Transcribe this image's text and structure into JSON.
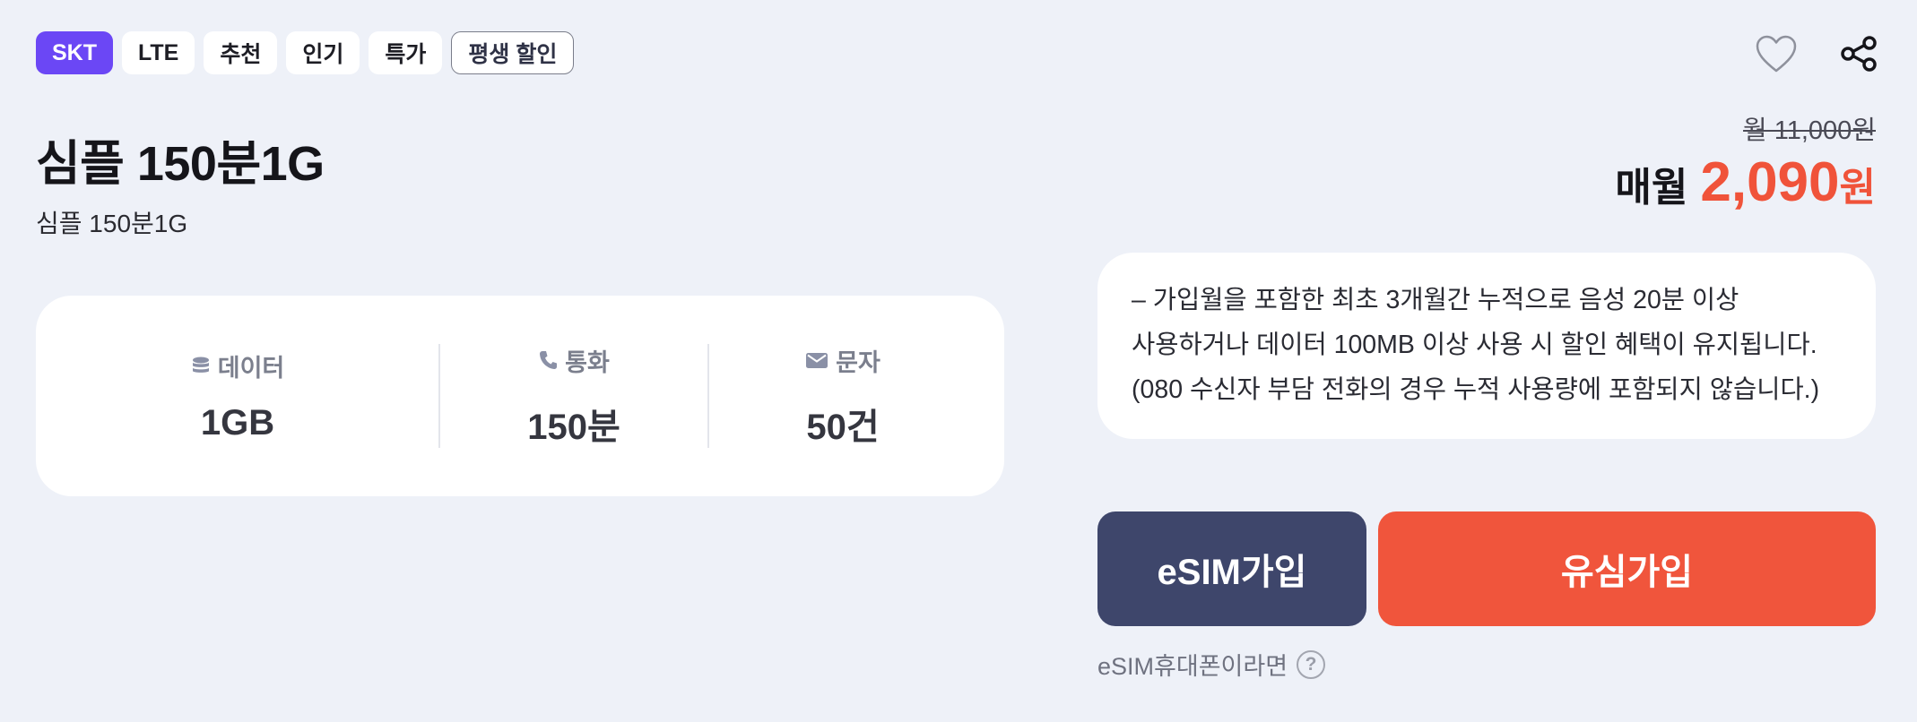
{
  "tags": {
    "carrier": "SKT",
    "network": "LTE",
    "recommended": "추천",
    "popular": "인기",
    "special": "특가",
    "lifetime_discount": "평생 할인"
  },
  "actions": {
    "favorite_icon": "heart-outline-icon",
    "share_icon": "share-icon"
  },
  "plan": {
    "title": "심플 150분1G",
    "subtitle": "심플 150분1G"
  },
  "price": {
    "original": "월 11,000원",
    "current_label": "매월",
    "current_value": "2,090",
    "current_unit": "원",
    "accent_color": "#f0533a"
  },
  "specs": {
    "data": {
      "icon": "database-icon",
      "label": "데이터",
      "value": "1GB"
    },
    "call": {
      "icon": "phone-icon",
      "label": "통화",
      "value": "150분"
    },
    "sms": {
      "icon": "envelope-icon",
      "label": "문자",
      "value": "50건"
    }
  },
  "notice": {
    "lines": [
      "– 가입월을 포함한 최초 3개월간 누적으로 음성 20분 이상",
      "사용하거나 데이터 100MB 이상 사용 시 할인 혜택이 유지됩니다.",
      "(080 수신자 부담 전화의 경우 누적 사용량에 포함되지 않습니다.)"
    ]
  },
  "buttons": {
    "esim": "eSIM가입",
    "usim": "유심가입",
    "esim_color": "#3e466b",
    "usim_color": "#f0553c"
  },
  "help": {
    "text": "eSIM휴대폰이라면",
    "icon": "question-circle-icon"
  }
}
